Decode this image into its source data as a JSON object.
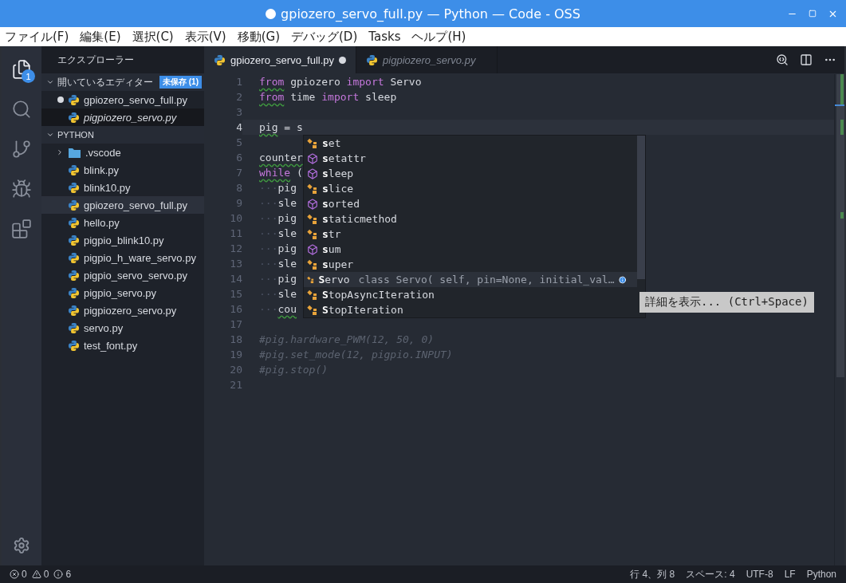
{
  "window": {
    "title": "gpiozero_servo_full.py — Python — Code - OSS",
    "dirty": true
  },
  "menu": [
    "ファイル(F)",
    "編集(E)",
    "選択(C)",
    "表示(V)",
    "移動(G)",
    "デバッグ(D)",
    "Tasks",
    "ヘルプ(H)"
  ],
  "activity_bar": {
    "items": [
      {
        "kind": "files",
        "selected": true,
        "badge": "1"
      },
      {
        "kind": "search",
        "selected": false
      },
      {
        "kind": "git",
        "selected": false
      },
      {
        "kind": "debug",
        "selected": false
      },
      {
        "kind": "extensions",
        "selected": false
      }
    ]
  },
  "sidebar": {
    "title": "エクスプローラー",
    "open_editors": {
      "title": "開いているエディター",
      "badge": "未保存 (1)",
      "expanded": true,
      "items": [
        {
          "label": "gpiozero_servo_full.py",
          "dirty": true,
          "preview": false,
          "selected": false
        },
        {
          "label": "pigpiozero_servo.py",
          "dirty": false,
          "preview": true,
          "selected": true
        }
      ]
    },
    "folder": {
      "title": "PYTHON",
      "expanded": true,
      "items": [
        {
          "label": ".vscode",
          "kind": "folder",
          "expanded": false,
          "selected": false
        },
        {
          "label": "blink.py",
          "kind": "python",
          "selected": false
        },
        {
          "label": "blink10.py",
          "kind": "python",
          "selected": false
        },
        {
          "label": "gpiozero_servo_full.py",
          "kind": "python",
          "selected": true
        },
        {
          "label": "hello.py",
          "kind": "python",
          "selected": false
        },
        {
          "label": "pigpio_blink10.py",
          "kind": "python",
          "selected": false
        },
        {
          "label": "pigpio_h_ware_servo.py",
          "kind": "python",
          "selected": false
        },
        {
          "label": "pigpio_servo_servo.py",
          "kind": "python",
          "selected": false
        },
        {
          "label": "pigpio_servo.py",
          "kind": "python",
          "selected": false
        },
        {
          "label": "pigpiozero_servo.py",
          "kind": "python",
          "selected": false
        },
        {
          "label": "servo.py",
          "kind": "python",
          "selected": false
        },
        {
          "label": "test_font.py",
          "kind": "python",
          "selected": false
        }
      ]
    }
  },
  "tabs": [
    {
      "label": "gpiozero_servo_full.py",
      "selected": true,
      "dirty": true,
      "preview": false
    },
    {
      "label": "pigpiozero_servo.py",
      "selected": false,
      "dirty": false,
      "preview": true
    }
  ],
  "editor": {
    "lines": [
      {
        "number": "1",
        "current": false,
        "tokens": [
          {
            "text": "from",
            "kind": "keyword",
            "squiggle": true
          },
          {
            "text": " gpiozero ",
            "kind": "plain"
          },
          {
            "text": "import",
            "kind": "keyword"
          },
          {
            "text": " Servo",
            "kind": "plain"
          }
        ]
      },
      {
        "number": "2",
        "current": false,
        "tokens": [
          {
            "text": "from",
            "kind": "keyword",
            "squiggle": true
          },
          {
            "text": " time ",
            "kind": "plain"
          },
          {
            "text": "import",
            "kind": "keyword"
          },
          {
            "text": " sleep",
            "kind": "plain"
          }
        ]
      },
      {
        "number": "3",
        "current": false
      },
      {
        "number": "4",
        "current": true,
        "tokens": [
          {
            "text": "pig",
            "kind": "plain",
            "squiggle": true
          },
          {
            "text": " = s",
            "kind": "plain"
          }
        ]
      },
      {
        "number": "5",
        "current": false
      },
      {
        "number": "6",
        "current": false,
        "tokens": [
          {
            "text": "counter",
            "kind": "plain",
            "squiggle": true
          }
        ]
      },
      {
        "number": "7",
        "current": false,
        "tokens": [
          {
            "text": "while",
            "kind": "keyword",
            "squiggle": true
          },
          {
            "text": " (",
            "kind": "plain"
          }
        ]
      },
      {
        "number": "8",
        "current": false,
        "tokens": [
          {
            "text": "···",
            "kind": "whitespace"
          },
          {
            "text": "pig",
            "kind": "plain"
          }
        ]
      },
      {
        "number": "9",
        "current": false,
        "tokens": [
          {
            "text": "···",
            "kind": "whitespace"
          },
          {
            "text": "sle",
            "kind": "plain"
          }
        ]
      },
      {
        "number": "10",
        "current": false,
        "tokens": [
          {
            "text": "···",
            "kind": "whitespace"
          },
          {
            "text": "pig",
            "kind": "plain"
          }
        ]
      },
      {
        "number": "11",
        "current": false,
        "tokens": [
          {
            "text": "···",
            "kind": "whitespace"
          },
          {
            "text": "sle",
            "kind": "plain"
          }
        ]
      },
      {
        "number": "12",
        "current": false,
        "tokens": [
          {
            "text": "···",
            "kind": "whitespace"
          },
          {
            "text": "pig",
            "kind": "plain"
          }
        ]
      },
      {
        "number": "13",
        "current": false,
        "tokens": [
          {
            "text": "···",
            "kind": "whitespace"
          },
          {
            "text": "sle",
            "kind": "plain"
          }
        ]
      },
      {
        "number": "14",
        "current": false,
        "tokens": [
          {
            "text": "···",
            "kind": "whitespace"
          },
          {
            "text": "pig",
            "kind": "plain"
          }
        ]
      },
      {
        "number": "15",
        "current": false,
        "tokens": [
          {
            "text": "···",
            "kind": "whitespace"
          },
          {
            "text": "sle",
            "kind": "plain"
          }
        ]
      },
      {
        "number": "16",
        "current": false,
        "tokens": [
          {
            "text": "···",
            "kind": "whitespace"
          },
          {
            "text": "cou",
            "kind": "plain",
            "squiggle": true
          }
        ]
      },
      {
        "number": "17",
        "current": false
      },
      {
        "number": "18",
        "current": false,
        "tokens": [
          {
            "text": "#pig.hardware_PWM(12, 50, 0)",
            "kind": "comment"
          }
        ]
      },
      {
        "number": "19",
        "current": false,
        "tokens": [
          {
            "text": "#pig.set_mode(12, pigpio.INPUT)",
            "kind": "comment"
          }
        ]
      },
      {
        "number": "20",
        "current": false,
        "tokens": [
          {
            "text": "#pig.stop()",
            "kind": "comment"
          }
        ]
      },
      {
        "number": "21",
        "current": false
      }
    ]
  },
  "suggestions": {
    "items": [
      {
        "match": "s",
        "rest": "et",
        "kind": "class",
        "selected": false
      },
      {
        "match": "s",
        "rest": "etattr",
        "kind": "function",
        "selected": false
      },
      {
        "match": "s",
        "rest": "leep",
        "kind": "function",
        "selected": false
      },
      {
        "match": "s",
        "rest": "lice",
        "kind": "class",
        "selected": false
      },
      {
        "match": "s",
        "rest": "orted",
        "kind": "function",
        "selected": false
      },
      {
        "match": "s",
        "rest": "taticmethod",
        "kind": "class",
        "selected": false
      },
      {
        "match": "s",
        "rest": "tr",
        "kind": "class",
        "selected": false
      },
      {
        "match": "s",
        "rest": "um",
        "kind": "function",
        "selected": false
      },
      {
        "match": "s",
        "rest": "uper",
        "kind": "class",
        "selected": false
      },
      {
        "match": "S",
        "rest": "ervo",
        "kind": "class",
        "selected": true,
        "detail": "class Servo( self, pin=None, initial_val…"
      },
      {
        "match": "S",
        "rest": "topAsyncIteration",
        "kind": "class",
        "selected": false
      },
      {
        "match": "S",
        "rest": "topIteration",
        "kind": "class",
        "selected": false
      }
    ],
    "tooltip": "詳細を表示... (Ctrl+Space)"
  },
  "status_bar": {
    "errors": "0",
    "warnings": "0",
    "infos": "6",
    "items": [
      "行 4、列 8",
      "スペース: 4",
      "UTF-8",
      "LF",
      "Python"
    ]
  }
}
